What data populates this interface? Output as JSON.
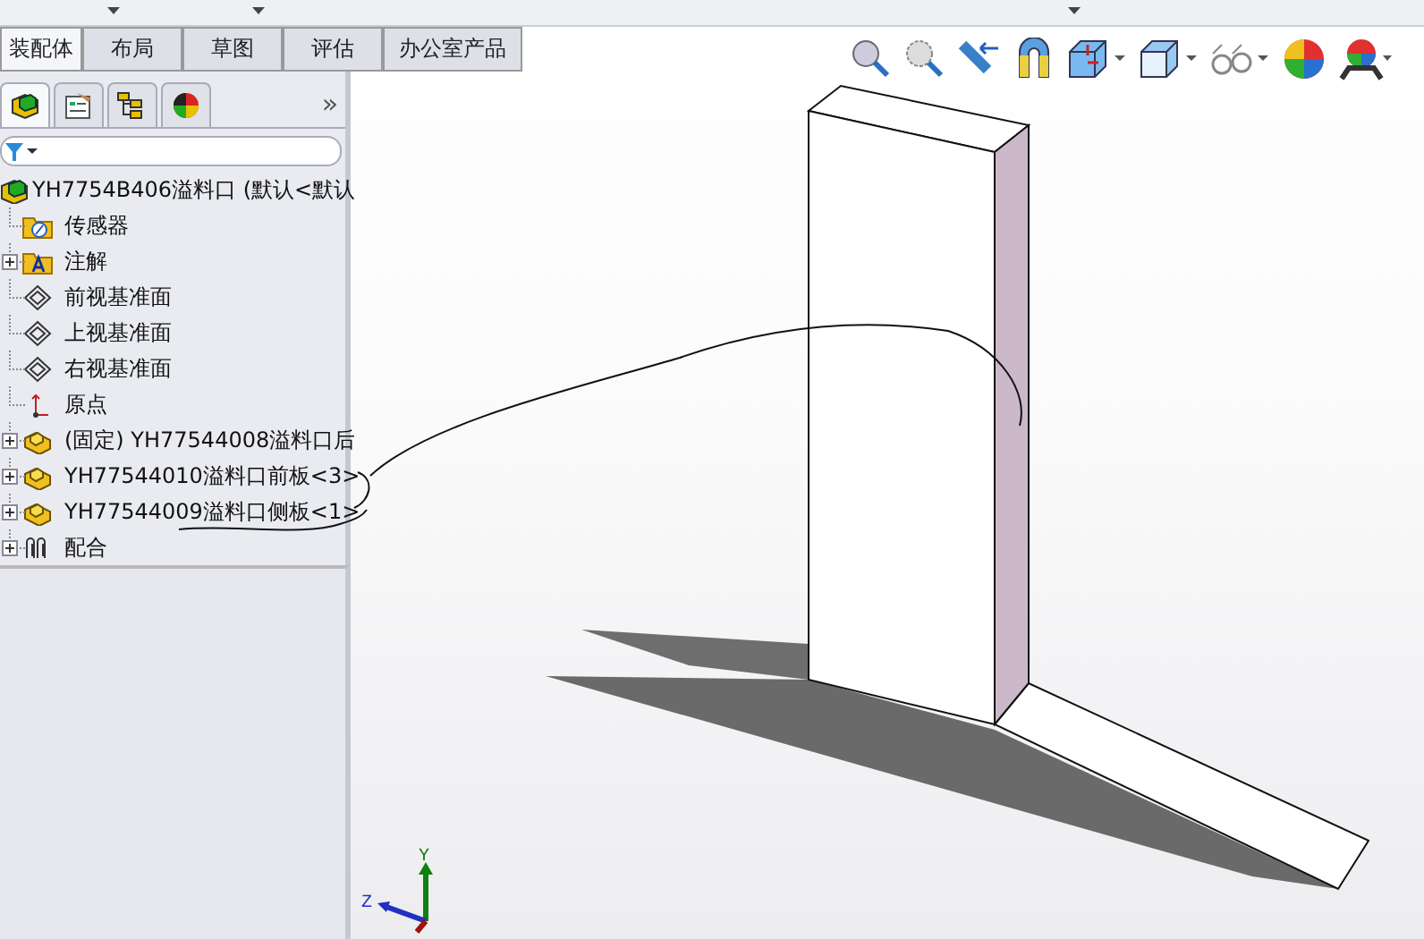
{
  "command_tabs": [
    {
      "label": "装配体",
      "selected": true
    },
    {
      "label": "布局",
      "selected": false
    },
    {
      "label": "草图",
      "selected": false
    },
    {
      "label": "评估",
      "selected": false
    },
    {
      "label": "办公室产品",
      "selected": false
    }
  ],
  "panel": {
    "tabs": [
      {
        "kind": "tree",
        "selected": true
      },
      {
        "kind": "property",
        "selected": false
      },
      {
        "kind": "config",
        "selected": false
      },
      {
        "kind": "display",
        "selected": false
      }
    ],
    "more": "»"
  },
  "tree": {
    "label": "YH7754B406溢料口 (默认<默认",
    "children": [
      {
        "kind": "sensor",
        "label": "传感器",
        "expandable": false
      },
      {
        "kind": "annotation",
        "label": "注解",
        "expandable": true
      },
      {
        "kind": "plane",
        "label": "前视基准面",
        "expandable": false
      },
      {
        "kind": "plane",
        "label": "上视基准面",
        "expandable": false
      },
      {
        "kind": "plane",
        "label": "右视基准面",
        "expandable": false
      },
      {
        "kind": "origin",
        "label": "原点",
        "expandable": false
      },
      {
        "kind": "part",
        "label": "(固定) YH77544008溢料口后",
        "expandable": true
      },
      {
        "kind": "part",
        "label": "YH77544010溢料口前板<3>",
        "expandable": true
      },
      {
        "kind": "part",
        "label": "YH77544009溢料口侧板<1>",
        "expandable": true
      },
      {
        "kind": "mates",
        "label": "配合",
        "expandable": true
      }
    ]
  },
  "triad": {
    "y": "Y",
    "z": "Z"
  }
}
